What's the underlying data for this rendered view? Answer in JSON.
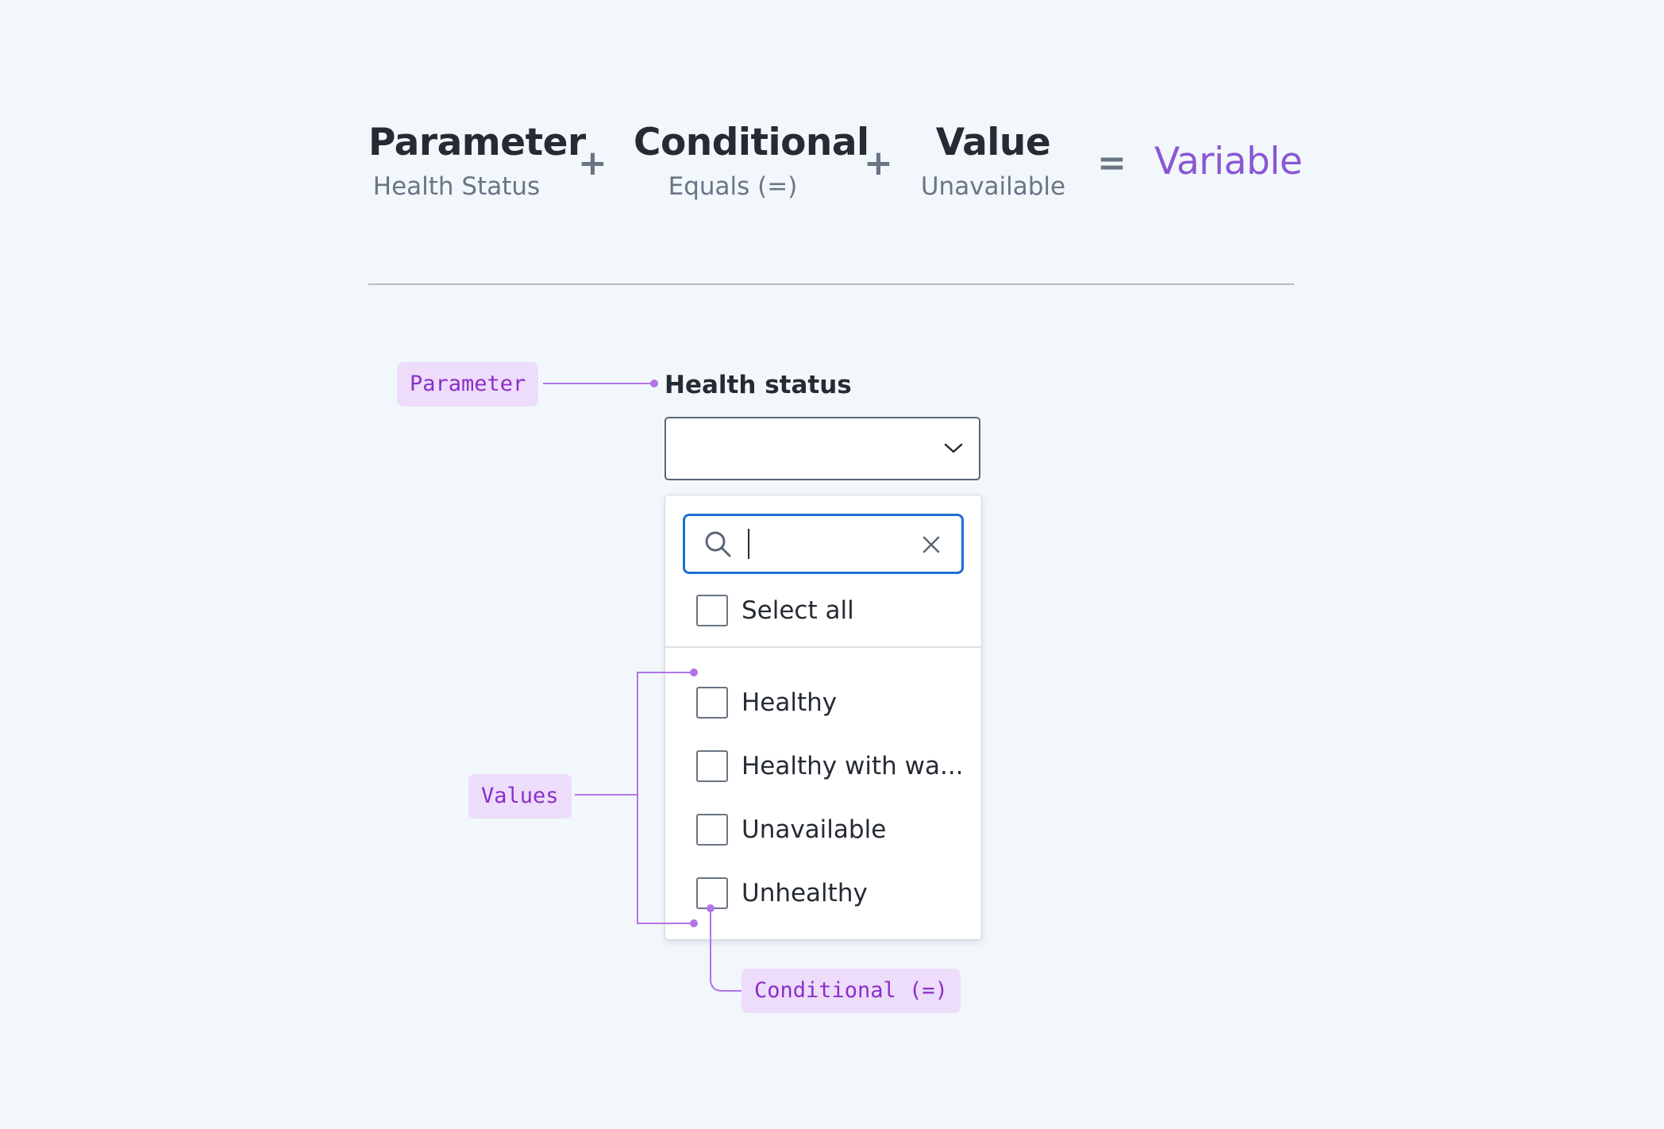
{
  "equation": {
    "parameter": {
      "title": "Parameter",
      "subtitle": "Health Status"
    },
    "plus1": "+",
    "conditional": {
      "title": "Conditional",
      "subtitle": "Equals (=)"
    },
    "plus2": "+",
    "value": {
      "title": "Value",
      "subtitle": "Unavailable"
    },
    "equals": "=",
    "result": "Variable"
  },
  "field": {
    "label": "Health status",
    "search": {
      "value": ""
    },
    "select_all": "Select all",
    "options": [
      {
        "label": "Healthy",
        "checked": false
      },
      {
        "label": "Healthy with wa...",
        "checked": false
      },
      {
        "label": "Unavailable",
        "checked": false
      },
      {
        "label": "Unhealthy",
        "checked": false
      }
    ]
  },
  "annotations": {
    "parameter": "Parameter",
    "values": "Values",
    "conditional": "Conditional (=)"
  },
  "colors": {
    "background": "#f2f7fb",
    "annotation_fill": "#eddcfa",
    "annotation_text": "#8a2fc9",
    "annotation_line": "#b274e8",
    "result": "#8a57d4",
    "focus": "#1f6fd0"
  },
  "icons": {
    "dropdown": "chevron-down-icon",
    "search": "search-icon",
    "clear": "close-icon"
  }
}
